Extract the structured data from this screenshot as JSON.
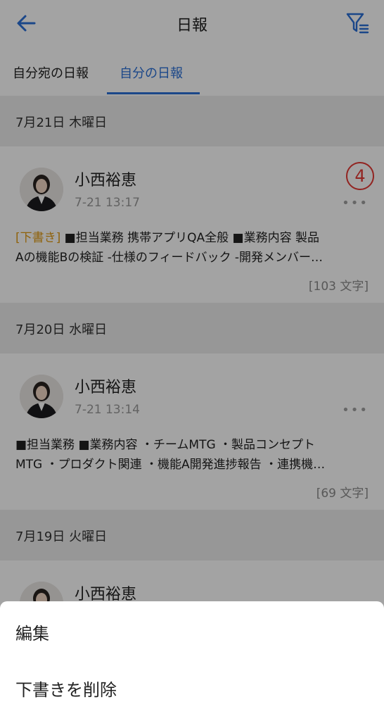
{
  "header": {
    "title": "日報",
    "back_icon": "back-arrow-icon",
    "filter_icon": "filter-icon"
  },
  "tabs": [
    {
      "label": "自分宛の日報",
      "active": false
    },
    {
      "label": "自分の日報",
      "active": true
    }
  ],
  "colors": {
    "accent": "#2b6fd6",
    "draft": "#e09a14",
    "annotation": "#e53935"
  },
  "sections": [
    {
      "date": "7月21日 木曜日",
      "report": {
        "name": "小西裕恵",
        "time": "7-21 13:17",
        "draft_tag": "[下書き]",
        "line1": "■担当業務 携帯アプリQA全般 ■業務内容 製品",
        "line2": "Aの機能Bの検証 -仕様のフィードバック -開発メンバー…",
        "count": "[103 文字]",
        "annotation": "4"
      }
    },
    {
      "date": "7月20日 水曜日",
      "report": {
        "name": "小西裕恵",
        "time": "7-21 13:14",
        "line1": "■担当業務 ■業務内容 ・チームMTG ・製品コンセプト",
        "line2": "MTG ・プロダクト関連 ・機能A開発進捗報告 ・連携機…",
        "count": "[69 文字]"
      }
    },
    {
      "date": "7月19日 火曜日",
      "report": {
        "name": "小西裕恵"
      }
    }
  ],
  "sheet": {
    "items": [
      "編集",
      "下書きを削除"
    ]
  }
}
